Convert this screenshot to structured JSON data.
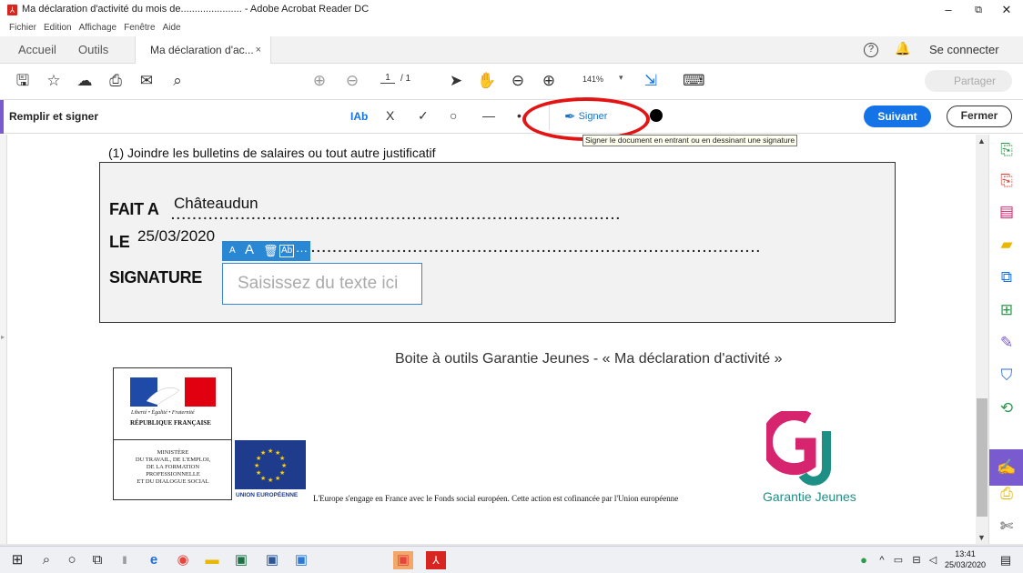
{
  "window": {
    "title": "Ma déclaration d'activité du mois de...................... - Adobe Acrobat Reader DC",
    "minimize": "–",
    "maximize": "⧉",
    "close": "✕"
  },
  "menu": [
    "Fichier",
    "Edition",
    "Affichage",
    "Fenêtre",
    "Aide"
  ],
  "tabs": {
    "home": "Accueil",
    "tools": "Outils",
    "document": "Ma déclaration d'ac...",
    "document_close": "×"
  },
  "header": {
    "help": "?",
    "connect": "Se connecter"
  },
  "toolbar": {
    "page_current": "1",
    "page_total": "/ 1",
    "zoom": "141%",
    "zoom_caret": "▾",
    "share": "Partager"
  },
  "fillsign": {
    "label": "Remplir et signer",
    "text_tool": "IAb",
    "cross_tool": "X",
    "check_tool": "✓",
    "circle_tool": "○",
    "line_tool": "—",
    "dot_tool": "•",
    "sign": "Signer",
    "next": "Suivant",
    "close": "Fermer",
    "tooltip": "Signer le document en entrant ou en dessinant une signature"
  },
  "document": {
    "note": "(1) Joindre les bulletins de salaires ou tout autre justificatif",
    "fait_label": "FAIT A",
    "fait_value": "Châteaudun",
    "le_label": "LE",
    "le_value": "25/03/2020",
    "signature_label": "SIGNATURE",
    "dots": "....................................................................................",
    "field_placeholder": "Saisissez du texte ici",
    "minibar": {
      "small_a": "A",
      "big_a": "A",
      "more": "···"
    },
    "footer_title": "Boite à outils Garantie Jeunes - « Ma déclaration d'activité »",
    "rf_motto": "Liberté • Égalité • Fraternité",
    "rf_name": "RÉPUBLIQUE FRANÇAISE",
    "ministere": [
      "MINISTÈRE",
      "DU TRAVAIL, DE L'EMPLOI,",
      "DE LA FORMATION",
      "PROFESSIONNELLE",
      "ET DU DIALOGUE SOCIAL"
    ],
    "eu_label": "UNION EUROPÉENNE",
    "eu_text": "L'Europe s'engage en France avec le Fonds social européen.  Cette action est cofinancée par l'Union européenne",
    "gj_label": "Garantie Jeunes"
  },
  "taskbar": {
    "time": "13:41",
    "date": "25/03/2020"
  },
  "colors": {
    "accent": "#1473e6",
    "purple": "#7a5bcf",
    "highlight": "#e31414",
    "gj_pink": "#d6246e",
    "gj_teal": "#1e8f84"
  }
}
